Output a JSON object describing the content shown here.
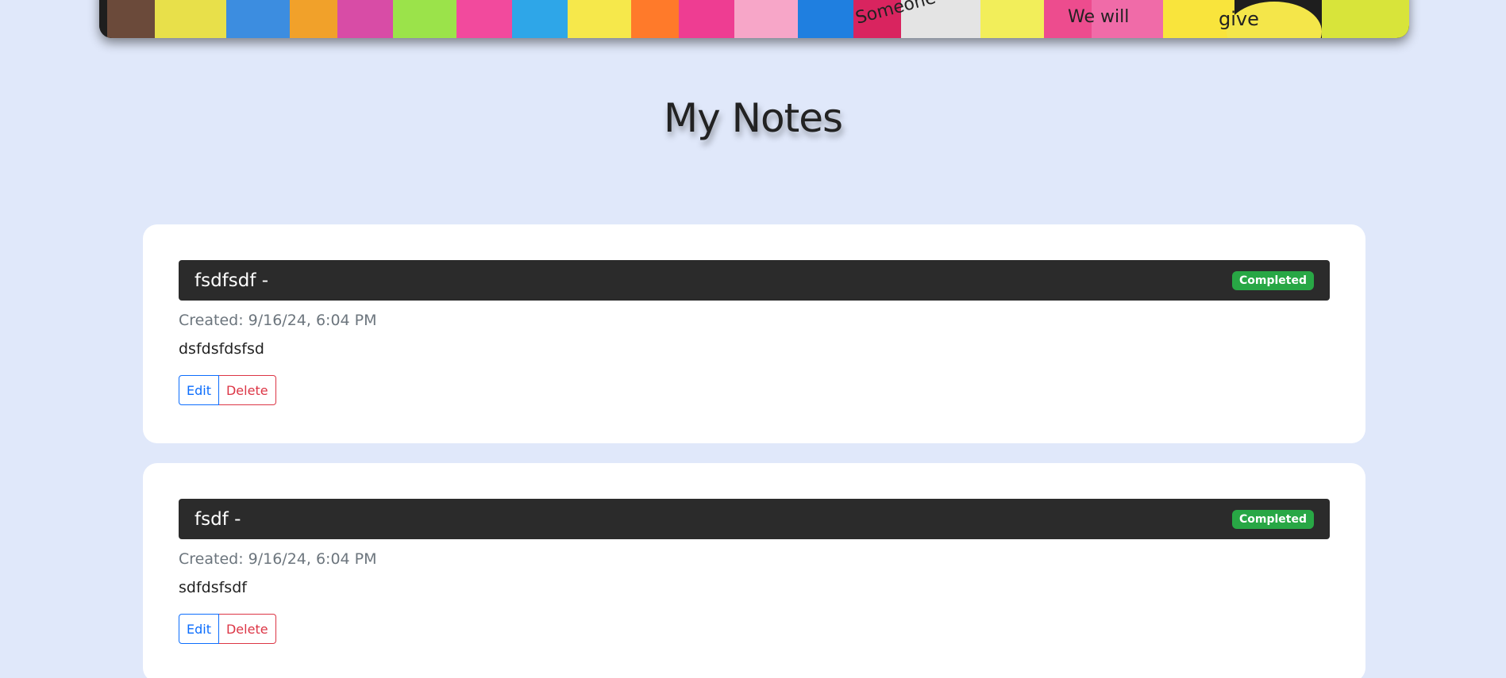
{
  "page": {
    "title": "My Notes"
  },
  "hero": {
    "image": "sticky-notes-wall-image",
    "scribbles": [
      "Someone",
      "We will",
      "give"
    ]
  },
  "notes": [
    {
      "title": "fsdfsdf -",
      "status": "Completed",
      "created": "Created: 9/16/24, 6:04 PM",
      "content": "dsfdsfdsfsd",
      "edit_label": "Edit",
      "delete_label": "Delete"
    },
    {
      "title": "fsdf -",
      "status": "Completed",
      "created": "Created: 9/16/24, 6:04 PM",
      "content": "sdfdsfsdf",
      "edit_label": "Edit",
      "delete_label": "Delete"
    }
  ],
  "colors": {
    "background": "#e0e8fa",
    "header_bar": "#2b2b2b",
    "badge": "#28a745",
    "edit": "#0d6efd",
    "delete": "#dc3545"
  }
}
